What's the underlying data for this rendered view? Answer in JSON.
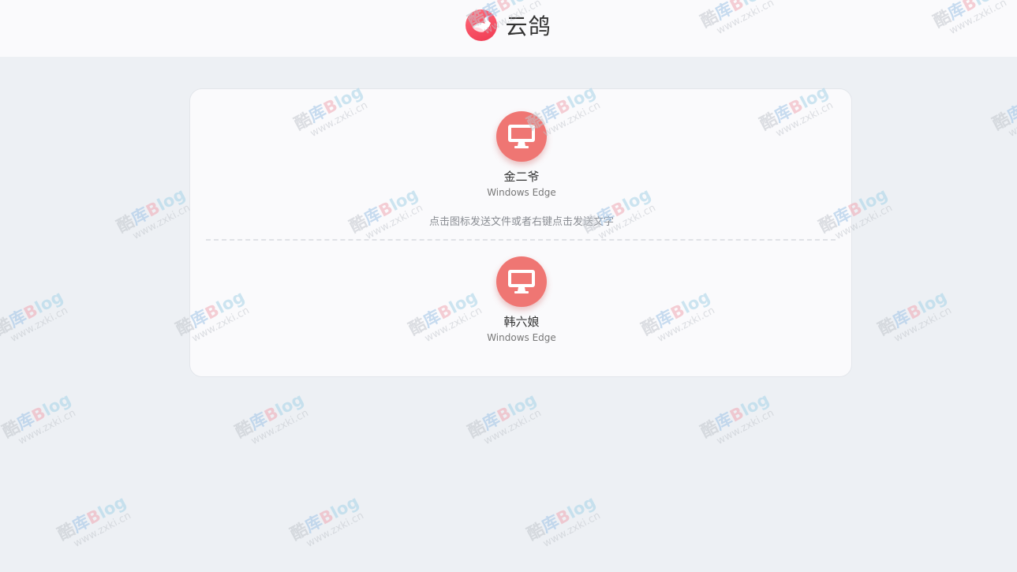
{
  "app": {
    "name": "云鸽"
  },
  "devices": [
    {
      "name": "金二爷",
      "os": "Windows Edge",
      "icon": "monitor-icon"
    },
    {
      "name": "韩六娘",
      "os": "Windows Edge",
      "icon": "monitor-icon"
    }
  ],
  "hint": "点击图标发送文件或者右键点击发送文字",
  "watermark": {
    "char1": "酷",
    "char2": "库",
    "word": "Blog",
    "url": "www.zxki.cn"
  },
  "colors": {
    "accent": "#ef7673",
    "logo": "#f03a52",
    "background": "#edf0f4",
    "card": "#fafafc"
  }
}
